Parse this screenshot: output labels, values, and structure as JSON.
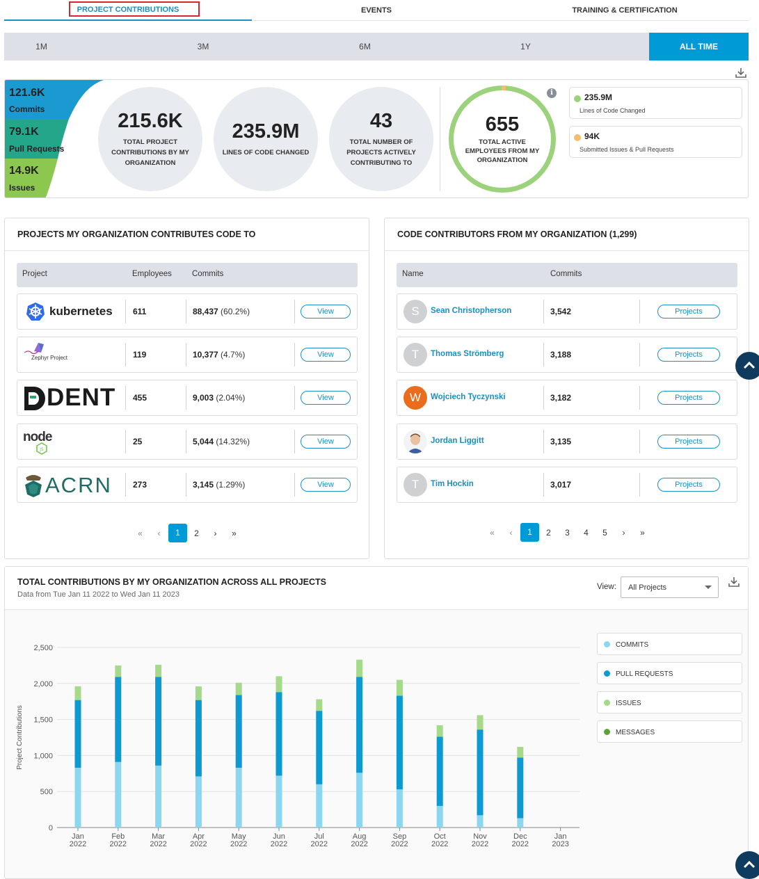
{
  "top_tabs": [
    {
      "label": "PROJECT CONTRIBUTIONS",
      "active": true
    },
    {
      "label": "EVENTS",
      "active": false
    },
    {
      "label": "TRAINING & CERTIFICATION",
      "active": false
    }
  ],
  "range_tabs": [
    {
      "label": "1M",
      "active": false
    },
    {
      "label": "3M",
      "active": false
    },
    {
      "label": "6M",
      "active": false
    },
    {
      "label": "1Y",
      "active": false
    },
    {
      "label": "ALL TIME",
      "active": true
    }
  ],
  "summary": {
    "commits": {
      "value": "121.6K",
      "label": "Commits"
    },
    "pull_requests": {
      "value": "79.1K",
      "label": "Pull Requests"
    },
    "issues": {
      "value": "14.9K",
      "label": "Issues"
    },
    "circles": [
      {
        "value": "215.6K",
        "label": "TOTAL PROJECT CONTRIBUTIONS BY MY ORGANIZATION"
      },
      {
        "value": "235.9M",
        "label": "LINES OF CODE CHANGED"
      },
      {
        "value": "43",
        "label": "TOTAL NUMBER OF PROJECTS ACTIVELY CONTRIBUTING TO"
      }
    ],
    "employees": {
      "value": "655",
      "label": "TOTAL ACTIVE EMPLOYEES FROM MY ORGANIZATION"
    },
    "info_icon": "info-icon",
    "legend": [
      {
        "value": "235.9M",
        "label": "Lines of Code Changed",
        "color": "#9dd27d"
      },
      {
        "value": "94K",
        "label": "Submitted Issues & Pull Requests",
        "color": "#f6bd6b"
      }
    ]
  },
  "projects_panel": {
    "title": "PROJECTS MY ORGANIZATION CONTRIBUTES CODE TO",
    "columns": [
      "Project",
      "Employees",
      "Commits"
    ],
    "rows": [
      {
        "logo": "kubernetes",
        "logo_text": "kubernetes",
        "employees": "611",
        "commits": "88,437",
        "pct": "(60.2%)",
        "action": "View"
      },
      {
        "logo": "zephyr",
        "logo_text": "Zephyr Project",
        "employees": "119",
        "commits": "10,377",
        "pct": "(4.7%)",
        "action": "View"
      },
      {
        "logo": "dent",
        "logo_text": "DENT",
        "employees": "455",
        "commits": "9,003",
        "pct": "(2.04%)",
        "action": "View"
      },
      {
        "logo": "node",
        "logo_text": "node",
        "employees": "25",
        "commits": "5,044",
        "pct": "(14.32%)",
        "action": "View"
      },
      {
        "logo": "acrn",
        "logo_text": "ACRN",
        "employees": "273",
        "commits": "3,145",
        "pct": "(1.29%)",
        "action": "View"
      }
    ],
    "pagination": {
      "pages": [
        "1",
        "2"
      ],
      "current": "1"
    }
  },
  "contributors_panel": {
    "title": "CODE CONTRIBUTORS FROM MY ORGANIZATION (1,299)",
    "columns": [
      "Name",
      "Commits"
    ],
    "rows": [
      {
        "initial": "S",
        "avatar_color": "#cfd0d2",
        "name": "Sean Christopherson",
        "commits": "3,542",
        "action": "Projects"
      },
      {
        "initial": "T",
        "avatar_color": "#cfd0d2",
        "name": "Thomas Strömberg",
        "commits": "3,188",
        "action": "Projects"
      },
      {
        "initial": "W",
        "avatar_color": "#ea6c1c",
        "name": "Wojciech Tyczynski",
        "commits": "3,182",
        "action": "Projects"
      },
      {
        "initial": "",
        "avatar_color": "#e6c2a4",
        "name": "Jordan Liggitt",
        "commits": "3,135",
        "action": "Projects"
      },
      {
        "initial": "T",
        "avatar_color": "#cfd0d2",
        "name": "Tim Hockin",
        "commits": "3,017",
        "action": "Projects"
      }
    ],
    "pagination": {
      "pages": [
        "1",
        "2",
        "3",
        "4",
        "5"
      ],
      "current": "1"
    }
  },
  "chart_panel": {
    "title": "TOTAL CONTRIBUTIONS BY MY ORGANIZATION ACROSS ALL PROJECTS",
    "subtitle": "Data from Tue Jan 11 2022 to Wed Jan 11 2023",
    "view_label": "View:",
    "view_value": "All Projects"
  },
  "chart_data": {
    "type": "bar",
    "stacked": true,
    "ylabel": "Project Contributions",
    "ylim": [
      0,
      2500
    ],
    "yticks": [
      "0",
      "500",
      "1,000",
      "1,500",
      "2,000",
      "2,500"
    ],
    "categories": [
      [
        "Jan",
        "2022"
      ],
      [
        "Feb",
        "2022"
      ],
      [
        "Mar",
        "2022"
      ],
      [
        "Apr",
        "2022"
      ],
      [
        "May",
        "2022"
      ],
      [
        "Jun",
        "2022"
      ],
      [
        "Jul",
        "2022"
      ],
      [
        "Aug",
        "2022"
      ],
      [
        "Sep",
        "2022"
      ],
      [
        "Oct",
        "2022"
      ],
      [
        "Nov",
        "2022"
      ],
      [
        "Dec",
        "2022"
      ],
      [
        "Jan",
        "2023"
      ]
    ],
    "series": [
      {
        "name": "COMMITS",
        "color": "#8dd6f0",
        "values": [
          830,
          910,
          860,
          710,
          830,
          720,
          600,
          760,
          530,
          300,
          170,
          130,
          0
        ]
      },
      {
        "name": "PULL REQUESTS",
        "color": "#0d9ad0",
        "values": [
          940,
          1180,
          1230,
          1060,
          1010,
          1160,
          1020,
          1330,
          1300,
          960,
          1190,
          840,
          0
        ]
      },
      {
        "name": "ISSUES",
        "color": "#a6d98a",
        "values": [
          190,
          160,
          170,
          190,
          170,
          220,
          160,
          240,
          220,
          160,
          200,
          150,
          0
        ]
      },
      {
        "name": "MESSAGES",
        "color": "#5ba43a",
        "values": [
          0,
          0,
          0,
          0,
          0,
          0,
          0,
          0,
          0,
          0,
          0,
          0,
          0
        ]
      }
    ],
    "legend": "right"
  }
}
